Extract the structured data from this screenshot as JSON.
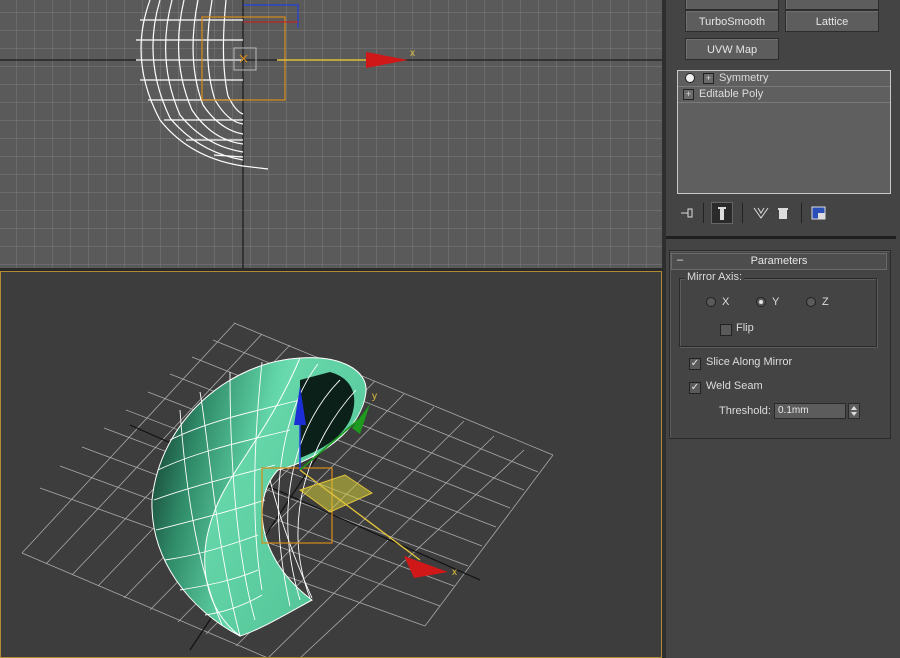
{
  "viewports": {
    "top": {
      "axis_label": "x"
    },
    "perspective": {
      "axis_label_x": "x",
      "axis_label_y": "y"
    }
  },
  "panel": {
    "buttons": {
      "turbosmooth": "TurboSmooth",
      "lattice": "Lattice",
      "uvw_map": "UVW Map"
    },
    "stack": {
      "items": [
        {
          "label": "Symmetry",
          "selected": true
        },
        {
          "label": "Editable Poly",
          "selected": false
        }
      ]
    },
    "rollout": {
      "collapse": "–",
      "title": "Parameters",
      "mirror_axis_label": "Mirror Axis:",
      "axis_x": "X",
      "axis_y": "Y",
      "axis_z": "Z",
      "selected_axis": "Y",
      "flip_label": "Flip",
      "flip_checked": false,
      "slice_label": "Slice Along Mirror",
      "slice_checked": true,
      "weld_label": "Weld Seam",
      "weld_checked": true,
      "threshold_label": "Threshold:",
      "threshold_value": "0.1mm"
    }
  },
  "colors": {
    "viewport_top_bg": "#5a5a5a",
    "viewport_persp_bg": "#3d3d3d",
    "active_border": "#b18a35",
    "mesh_fill": "#52c99a",
    "gizmo_red": "#d11818",
    "gizmo_green": "#1e9a1e",
    "gizmo_blue": "#1c2fd6"
  }
}
